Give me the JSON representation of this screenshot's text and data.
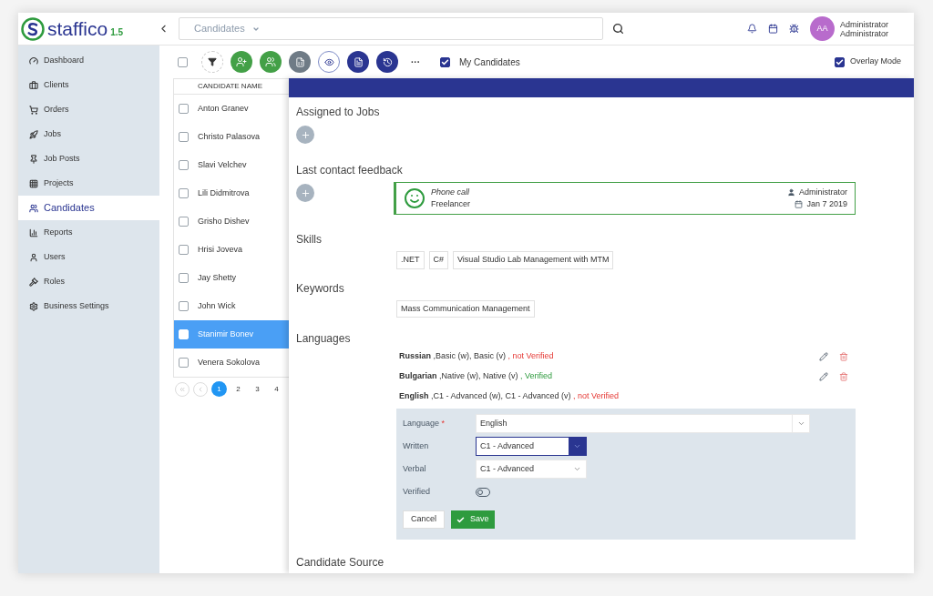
{
  "header": {
    "logo": "staffico",
    "version": "1.5",
    "search": {
      "scope": "Candidates"
    },
    "user": {
      "initials": "AA",
      "first": "Administrator",
      "last": "Administrator"
    }
  },
  "sidebar": {
    "items": [
      {
        "label": "Dashboard",
        "selected": false
      },
      {
        "label": "Clients",
        "selected": false
      },
      {
        "label": "Orders",
        "selected": false
      },
      {
        "label": "Jobs",
        "selected": false
      },
      {
        "label": "Job Posts",
        "selected": false
      },
      {
        "label": "Projects",
        "selected": false
      },
      {
        "label": "Candidates",
        "selected": true
      },
      {
        "label": "Reports",
        "selected": false
      },
      {
        "label": "Users",
        "selected": false
      },
      {
        "label": "Roles",
        "selected": false
      },
      {
        "label": "Business Settings",
        "selected": false
      }
    ]
  },
  "toolbar": {
    "more": "···",
    "my_candidates": {
      "label": "My Candidates",
      "checked": true
    },
    "overlay_mode": {
      "label": "Overlay Mode",
      "checked": true
    }
  },
  "list": {
    "all_checked": false,
    "column": "CANDIDATE NAME",
    "rows": [
      {
        "name": "Anton Granev",
        "selected": false
      },
      {
        "name": "Christo Palasova",
        "selected": false
      },
      {
        "name": "Slavi Velchev",
        "selected": false
      },
      {
        "name": "Lili Didmitrova",
        "selected": false
      },
      {
        "name": "Grisho Dishev",
        "selected": false
      },
      {
        "name": "Hrisi Joveva",
        "selected": false
      },
      {
        "name": "Jay Shetty",
        "selected": false
      },
      {
        "name": "John Wick",
        "selected": false
      },
      {
        "name": "Stanimir Bonev",
        "selected": true
      },
      {
        "name": "Venera Sokolova",
        "selected": false
      }
    ],
    "pages": [
      {
        "label": "1",
        "selected": true
      },
      {
        "label": "2",
        "selected": false
      },
      {
        "label": "3",
        "selected": false
      },
      {
        "label": "4",
        "selected": false
      }
    ]
  },
  "detail": {
    "assigned_title": "Assigned to Jobs",
    "feedback_title": "Last contact feedback",
    "feedback": {
      "type": "Phone call",
      "note": "Freelancer",
      "author": "Administrator",
      "date": "Jan 7 2019"
    },
    "skills_title": "Skills",
    "skills": [
      ".NET",
      "C#",
      "Visual Studio Lab Management with MTM"
    ],
    "keywords_title": "Keywords",
    "keywords": [
      "Mass Communication Management"
    ],
    "languages_title": "Languages",
    "languages": [
      {
        "name": "Russian",
        "details": " ,Basic (w), Basic (v) ",
        "status": ", not Verified",
        "verified": false,
        "editable": true
      },
      {
        "name": "Bulgarian",
        "details": " ,Native (w), Native (v) ",
        "status": ", Verified",
        "verified": true,
        "editable": true
      },
      {
        "name": "English",
        "details": " ,C1 - Advanced (w), C1 - Advanced (v) ",
        "status": ", not Verified",
        "verified": false,
        "editable": false
      }
    ],
    "form": {
      "fields": [
        {
          "label": "Language",
          "required": true,
          "value": "English",
          "focused": false,
          "wide": true
        },
        {
          "label": "Written",
          "required": false,
          "value": "C1 - Advanced",
          "focused": true,
          "wide": false
        },
        {
          "label": "Verbal",
          "required": false,
          "value": "C1 - Advanced",
          "focused": false,
          "wide": false
        }
      ],
      "required_mark": "*",
      "verified": {
        "label": "Verified",
        "on": false
      },
      "cancel": "Cancel",
      "save": "Save"
    },
    "source_title": "Candidate Source"
  }
}
